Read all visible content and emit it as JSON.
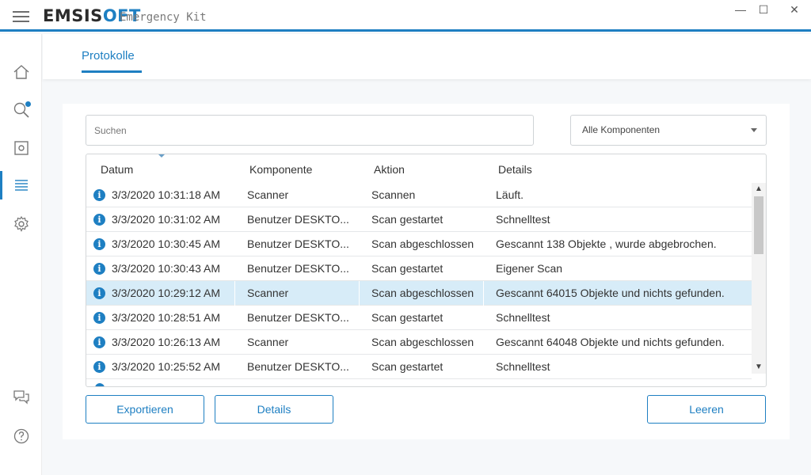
{
  "app": {
    "brand_a": "EMSIS",
    "brand_b": "OFT",
    "subtitle": "Emergency Kit",
    "window_buttons": {
      "minimize": "—",
      "maximize": "☐",
      "close": "✕"
    },
    "accent_color": "#1e7fc2"
  },
  "sidebar": {
    "items": [
      {
        "name": "home",
        "icon": "home-icon"
      },
      {
        "name": "scan",
        "icon": "search-icon",
        "badge": true
      },
      {
        "name": "quarantine",
        "icon": "quarantine-icon"
      },
      {
        "name": "logs",
        "icon": "list-icon",
        "active": true
      },
      {
        "name": "settings",
        "icon": "gear-icon"
      },
      {
        "name": "feedback",
        "icon": "chat-icon"
      },
      {
        "name": "help",
        "icon": "help-icon"
      }
    ]
  },
  "header": {
    "tab_label": "Protokolle"
  },
  "filters": {
    "search_placeholder": "Suchen",
    "component_select": "Alle Komponenten"
  },
  "table": {
    "columns": {
      "date": "Datum",
      "component": "Komponente",
      "action": "Aktion",
      "details": "Details"
    },
    "rows": [
      {
        "date": "3/3/2020 10:31:18 AM",
        "component": "Scanner",
        "action": "Scannen",
        "details": "Läuft."
      },
      {
        "date": "3/3/2020 10:31:02 AM",
        "component": "Benutzer DESKTO...",
        "action": "Scan gestartet",
        "details": "Schnelltest"
      },
      {
        "date": "3/3/2020 10:30:45 AM",
        "component": "Benutzer DESKTO...",
        "action": "Scan abgeschlossen",
        "details": "Gescannt 138 Objekte , wurde abgebrochen."
      },
      {
        "date": "3/3/2020 10:30:43 AM",
        "component": "Benutzer DESKTO...",
        "action": "Scan gestartet",
        "details": "Eigener Scan"
      },
      {
        "date": "3/3/2020 10:29:12 AM",
        "component": "Scanner",
        "action": "Scan abgeschlossen",
        "details": "Gescannt 64015 Objekte und nichts gefunden.",
        "selected": true
      },
      {
        "date": "3/3/2020 10:28:51 AM",
        "component": "Benutzer DESKTO...",
        "action": "Scan gestartet",
        "details": "Schnelltest"
      },
      {
        "date": "3/3/2020 10:26:13 AM",
        "component": "Scanner",
        "action": "Scan abgeschlossen",
        "details": "Gescannt 64048 Objekte und nichts gefunden."
      },
      {
        "date": "3/3/2020 10:25:52 AM",
        "component": "Benutzer DESKTO...",
        "action": "Scan gestartet",
        "details": "Schnelltest"
      }
    ]
  },
  "buttons": {
    "export": "Exportieren",
    "details": "Details",
    "clear": "Leeren"
  }
}
